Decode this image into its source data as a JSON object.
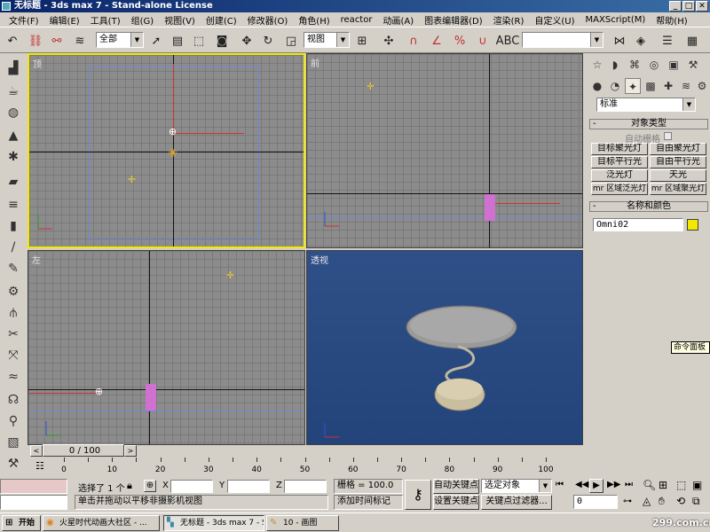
{
  "window": {
    "title": "无标题 - 3ds max 7 - Stand-alone License"
  },
  "menu": [
    "文件(F)",
    "编辑(E)",
    "工具(T)",
    "组(G)",
    "视图(V)",
    "创建(C)",
    "修改器(O)",
    "角色(H)",
    "reactor",
    "动画(A)",
    "图表编辑器(D)",
    "渲染(R)",
    "自定义(U)",
    "MAXScript(M)",
    "帮助(H)"
  ],
  "toolbar": {
    "selection_filter": "全部",
    "ref_coord": "视图",
    "named_selection": ""
  },
  "viewports": {
    "top": "顶",
    "front": "前",
    "left": "左",
    "perspective": "透视"
  },
  "command_panel": {
    "category_dropdown": "标准",
    "rollout_object_type": "对象类型",
    "autogrid_label": "自动栅格",
    "light_buttons": [
      "目标聚光灯",
      "自由聚光灯",
      "目标平行光",
      "自由平行光",
      "泛光灯",
      "天光",
      "mr 区域泛光灯",
      "mr 区域聚光灯"
    ],
    "rollout_name_color": "名称和颜色",
    "object_name": "Omni02",
    "object_color": "#f4e800"
  },
  "timeline": {
    "frame_display": "0 / 100",
    "ticks": [
      0,
      10,
      20,
      30,
      40,
      50,
      60,
      70,
      80,
      90,
      100
    ]
  },
  "status": {
    "selected": "选择了 1 个",
    "x_label": "X",
    "y_label": "Y",
    "z_label": "Z",
    "grid": "栅格 = 100.0",
    "prompt": "单击并拖动以平移非摄影机视图",
    "add_time_tag": "添加时间标记",
    "auto_key": "自动关键点",
    "set_key": "设置关键点",
    "key_filter_dropdown": "选定对象",
    "key_filters": "关键点过滤器...",
    "current_frame": "0"
  },
  "tooltip": "命令面板",
  "taskbar": {
    "start": "开始",
    "tasks": [
      "火星时代动画大社区 - ...",
      "无标题 - 3ds max 7 - St...",
      "10 - 画图"
    ]
  },
  "watermark": "299.com.cn"
}
